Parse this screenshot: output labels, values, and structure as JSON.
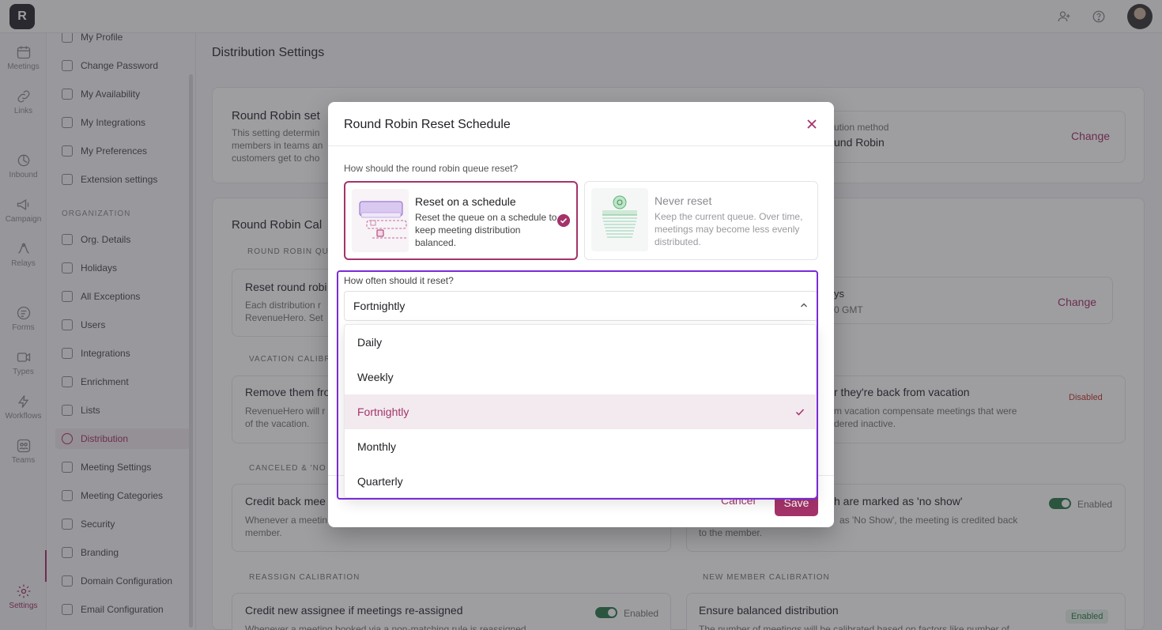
{
  "app": {
    "logo_text": "R",
    "top_icons": [
      "user-plus-icon",
      "help-circle-icon"
    ]
  },
  "rail": {
    "items": [
      {
        "label": "Meetings",
        "icon": "calendar-icon"
      },
      {
        "label": "Links",
        "icon": "link-icon"
      },
      {
        "label": "Inbound",
        "icon": "inbound-icon"
      },
      {
        "label": "Campaign",
        "icon": "megaphone-icon"
      },
      {
        "label": "Relays",
        "icon": "relay-icon"
      },
      {
        "label": "Forms",
        "icon": "forms-icon"
      },
      {
        "label": "Types",
        "icon": "types-icon"
      },
      {
        "label": "Workflows",
        "icon": "bolt-icon"
      },
      {
        "label": "Teams",
        "icon": "teams-icon"
      },
      {
        "label": "Settings",
        "icon": "gear-icon"
      }
    ]
  },
  "sidebar": {
    "personal": [
      "My Profile",
      "Change Password",
      "My Availability",
      "My Integrations",
      "My Preferences",
      "Extension settings"
    ],
    "section_label": "ORGANIZATION",
    "org": [
      "Org. Details",
      "Holidays",
      "All Exceptions",
      "Users",
      "Integrations",
      "Enrichment",
      "Lists",
      "Distribution",
      "Meeting Settings",
      "Meeting Categories",
      "Security",
      "Branding",
      "Domain Configuration",
      "Email Configuration"
    ],
    "active": "Distribution"
  },
  "main": {
    "title": "Distribution Settings",
    "rr_settings_head": "Round Robin set",
    "rr_settings_desc": [
      "This setting determin",
      "members in teams an",
      "customers get to cho"
    ],
    "dist_method_label": "ution method",
    "dist_method_value": "und Robin",
    "change": "Change",
    "calib_head": "Round Robin Cal",
    "calib_label": "ROUND ROBIN QUE",
    "reset_head": "Reset round robi",
    "reset_desc": [
      "Each distribution r",
      "RevenueHero. Set"
    ],
    "reset_right_a": "ys",
    "reset_right_b": "0 GMT",
    "vacation_label": "VACATION CALIBRA",
    "vacation_head": "Remove them fro",
    "vacation_desc": [
      "RevenueHero will r",
      "of the vacation."
    ],
    "vacation_right_head": "r they're back from vacation",
    "vacation_right_desc": [
      "m vacation compensate meetings that were",
      "dered inactive."
    ],
    "disabled": "Disabled",
    "canceled_label": "CANCELED & 'NO SH",
    "credit_head": "Credit back mee",
    "credit_desc": [
      "Whenever a meetin",
      "member."
    ],
    "noshow_head": "h are marked as 'no show'",
    "noshow_desc": [
      "as 'No Show', the meeting is credited back",
      "to the member."
    ],
    "enabled": "Enabled",
    "reassign_label": "REASSIGN CALIBRATION",
    "reassign_head": "Credit new assignee if meetings re-assigned",
    "reassign_desc": "Whenever a meeting booked via a non-matching rule is reassigned",
    "newmember_label": "NEW MEMBER CALIBRATION",
    "newmember_head": "Ensure balanced distribution",
    "newmember_desc": "The number of meetings will be calibrated based on factors like number of",
    "enabled_badge": "Enabled"
  },
  "modal": {
    "title": "Round Robin Reset Schedule",
    "question": "How should the round robin queue reset?",
    "options": [
      {
        "title": "Reset on a schedule",
        "desc": "Reset the queue on a schedule to keep meeting distribution balanced.",
        "selected": true
      },
      {
        "title": "Never reset",
        "desc": "Keep the current queue. Over time, meetings may become less evenly distributed.",
        "selected": false
      }
    ],
    "freq_label": "How often should it reset?",
    "freq_value": "Fortnightly",
    "freq_options": [
      "Daily",
      "Weekly",
      "Fortnightly",
      "Monthly",
      "Quarterly"
    ],
    "cancel": "Cancel",
    "save": "Save"
  },
  "colors": {
    "accent": "#a4336a",
    "focus_outline": "#7a2bd9",
    "enabled_green": "#2f7a4d",
    "disabled_red": "#c0392b"
  }
}
